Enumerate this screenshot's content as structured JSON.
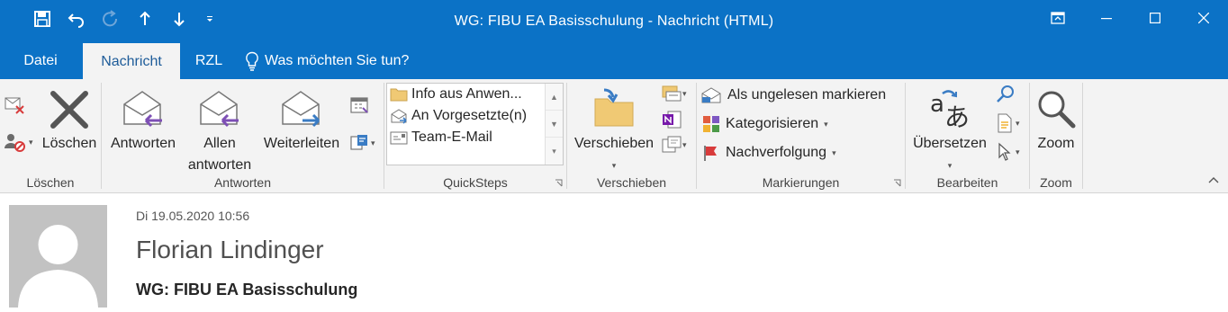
{
  "window": {
    "title": "WG: FIBU EA Basisschulung - Nachricht (HTML)"
  },
  "tabs": [
    {
      "label": "Datei"
    },
    {
      "label": "Nachricht"
    },
    {
      "label": "RZL"
    }
  ],
  "tell_me": {
    "placeholder": "Was möchten Sie tun?"
  },
  "groups": {
    "loeschen": {
      "label": "Löschen",
      "delete_label": "Löschen"
    },
    "antworten": {
      "label": "Antworten",
      "reply_label": "Antworten",
      "reply_all_line1": "Allen",
      "reply_all_line2": "antworten",
      "forward_label": "Weiterleiten"
    },
    "quicksteps": {
      "label": "QuickSteps",
      "items": [
        "Info aus Anwen...",
        "An Vorgesetzte(n)",
        "Team-E-Mail"
      ]
    },
    "verschieben": {
      "label": "Verschieben",
      "move_label": "Verschieben"
    },
    "markierungen": {
      "label": "Markierungen",
      "unread_label": "Als ungelesen markieren",
      "categorize_label": "Kategorisieren",
      "followup_label": "Nachverfolgung"
    },
    "bearbeiten": {
      "label": "Bearbeiten",
      "translate_label": "Übersetzen"
    },
    "zoom": {
      "label": "Zoom",
      "zoom_label": "Zoom"
    }
  },
  "message": {
    "date": "Di 19.05.2020 10:56",
    "sender": "Florian Lindinger",
    "subject": "WG: FIBU EA Basisschulung"
  },
  "colors": {
    "accent": "#0b72c6",
    "ribbon_bg": "#f3f3f3",
    "active_tab_text": "#1e5c99"
  },
  "icons": {
    "save": "save-icon",
    "undo": "undo-icon",
    "redo": "redo-icon",
    "up": "arrow-up-icon",
    "down": "arrow-down-icon",
    "customize": "customize-qat-icon",
    "restore_ribbon": "ribbon-display-icon",
    "minimize": "minimize-icon",
    "maximize": "maximize-icon",
    "close": "close-icon",
    "lightbulb": "lightbulb-icon"
  }
}
